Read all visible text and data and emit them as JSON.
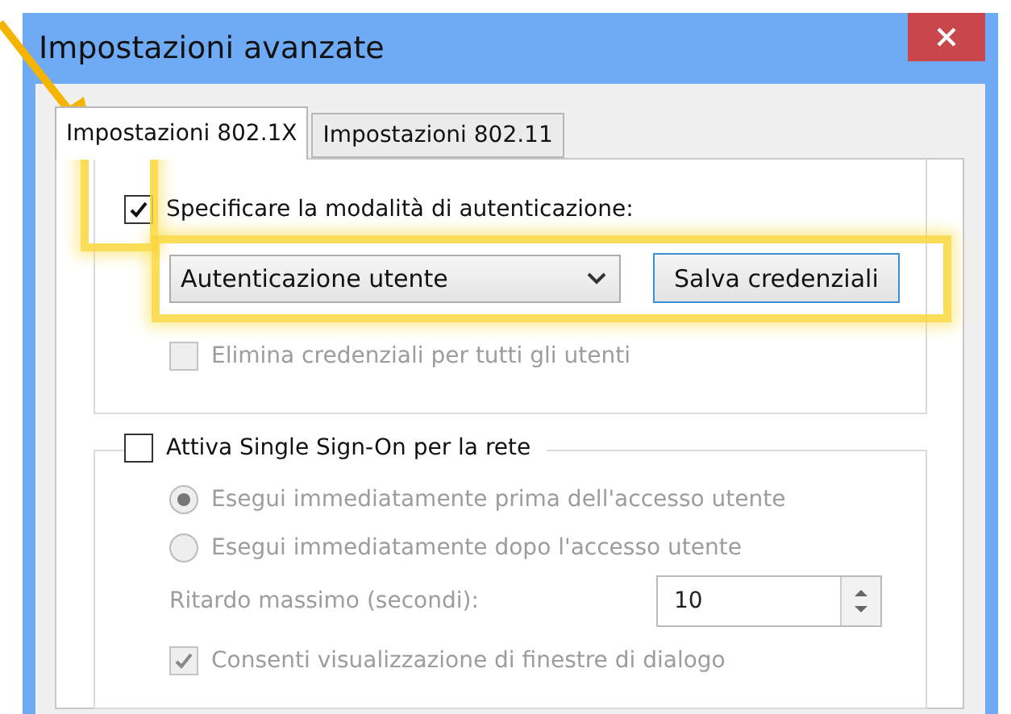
{
  "window": {
    "title": "Impostazioni avanzate"
  },
  "tabs": [
    {
      "label": "Impostazioni 802.1X",
      "selected": true
    },
    {
      "label": "Impostazioni 802.11",
      "selected": false
    }
  ],
  "auth": {
    "checkbox": {
      "label": "Specificare la modalità di autenticazione:",
      "checked": true
    },
    "mode": {
      "value": "Autenticazione utente"
    },
    "save_button": "Salva credenziali",
    "delete_all": {
      "label": "Elimina credenziali per tutti gli utenti",
      "checked": false,
      "disabled": true
    }
  },
  "sso": {
    "checkbox": {
      "label": "Attiva Single Sign-On per la rete",
      "checked": false
    },
    "disabled": true,
    "options": [
      {
        "label": "Esegui immediatamente prima dell'accesso utente",
        "selected": true
      },
      {
        "label": "Esegui immediatamente dopo l'accesso utente",
        "selected": false
      }
    ],
    "delay": {
      "label": "Ritardo massimo (secondi):",
      "value": "10"
    },
    "allow_dialogs": {
      "label": "Consenti visualizzazione di finestre di dialogo",
      "checked": true
    }
  }
}
